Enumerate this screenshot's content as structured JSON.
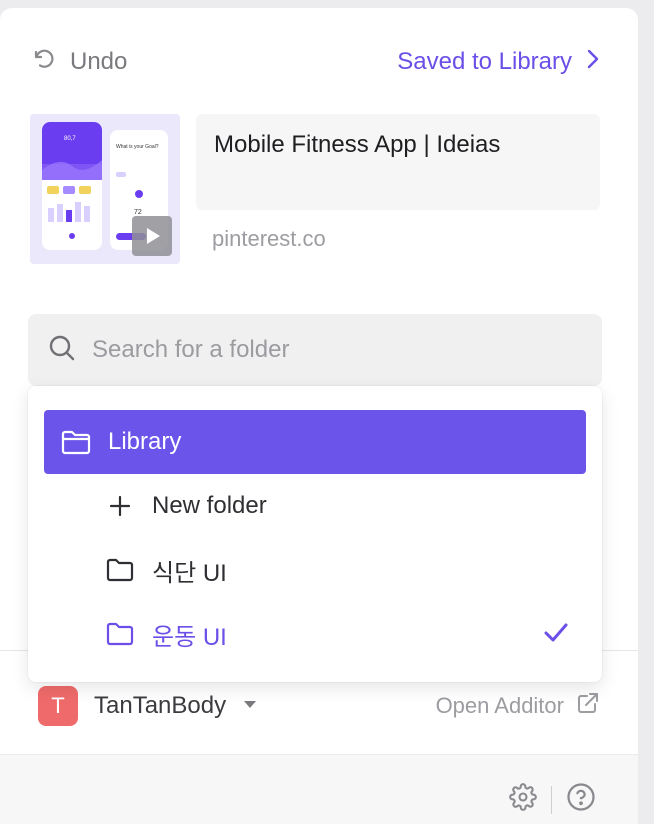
{
  "header": {
    "undo_label": "Undo",
    "saved_label": "Saved to Library"
  },
  "card": {
    "title": "Mobile Fitness App | Ideias",
    "source": "pinterest.co",
    "thumbnail": {
      "metric": "80,7",
      "question": "What is your Goal?",
      "count": "72"
    }
  },
  "search": {
    "placeholder": "Search for a folder",
    "value": ""
  },
  "folders": {
    "library_label": "Library",
    "new_folder_label": "New folder",
    "items": [
      {
        "label": "식단 UI",
        "checked": false
      },
      {
        "label": "운동 UI",
        "checked": true
      }
    ]
  },
  "footer": {
    "avatar_letter": "T",
    "workspace_name": "TanTanBody",
    "open_additor_label": "Open Additor"
  },
  "colors": {
    "accent": "#6b54e9",
    "avatar": "#ef6b6b"
  }
}
